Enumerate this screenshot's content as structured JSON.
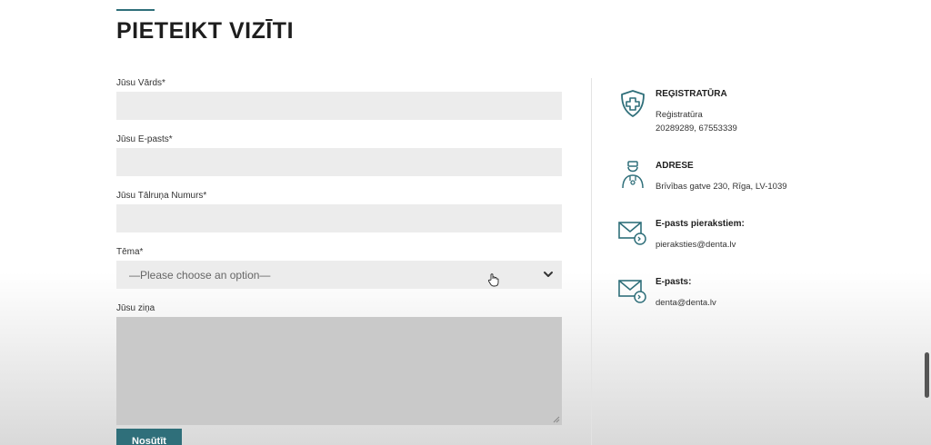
{
  "page": {
    "title": "PIETEIKT VIZĪTI"
  },
  "form": {
    "name_label": "Jūsu Vārds*",
    "email_label": "Jūsu E-pasts*",
    "phone_label": "Jūsu Tālruņa Numurs*",
    "topic_label": "Tēma*",
    "topic_selected": "—Please choose an option—",
    "message_label": "Jūsu ziņa",
    "submit_label": "Nosūtīt"
  },
  "contacts": {
    "registry": {
      "heading": "REĢISTRATŪRA",
      "line1": "Reģistratūra",
      "line2": "20289289, 67553339",
      "icon": "shield-cross-icon"
    },
    "address": {
      "heading": "ADRESE",
      "line1": "Brīvības gatve 230, Rīga, LV-1039",
      "icon": "doctor-icon"
    },
    "appointment_email": {
      "heading": "E-pasts pierakstiem:",
      "line1": "pieraksties@denta.lv",
      "icon": "envelope-icon"
    },
    "general_email": {
      "heading": "E-pasts:",
      "line1": "denta@denta.lv",
      "icon": "envelope-icon"
    }
  },
  "colors": {
    "accent": "#2f6f7a",
    "field_bg": "#ececec"
  }
}
